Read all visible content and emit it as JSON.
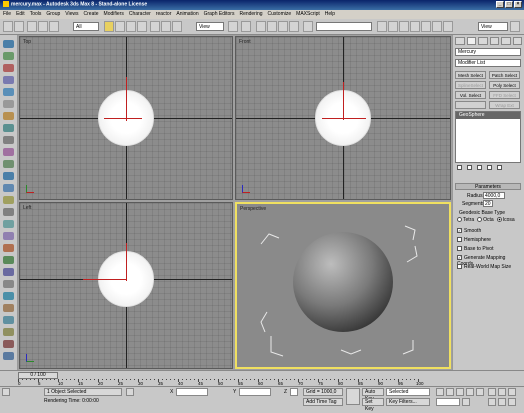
{
  "window": {
    "title": "mercury.max - Autodesk 3ds Max 8 - Stand-alone License"
  },
  "menu": [
    "File",
    "Edit",
    "Tools",
    "Group",
    "Views",
    "Create",
    "Modifiers",
    "Character",
    "reactor",
    "Animation",
    "Graph Editors",
    "Rendering",
    "Customize",
    "MAXScript",
    "Help"
  ],
  "toolbar": {
    "selection_filter": "All",
    "refcoord": "View",
    "named_selection": "",
    "view_dropdown": "View"
  },
  "viewports": {
    "top": "Top",
    "front": "Front",
    "left": "Left",
    "perspective": "Perspective"
  },
  "panel": {
    "object_name": "Mercury",
    "modifier_list": "Modifier List",
    "buttons": [
      "Mesh Select",
      "Patch Select",
      "SplineSelect",
      "Poly Select",
      "Vol. Select",
      "FFD Select",
      "",
      "Wrap Ext"
    ],
    "stack_item": "GeoSphere",
    "rollout": "Parameters",
    "radius_label": "Radius:",
    "radius_value": "4000,0",
    "segments_label": "Segments:",
    "segments_value": "20",
    "geodesic_label": "Geodesic Base Type",
    "types": [
      "Tetra",
      "Octa",
      "Icosa"
    ],
    "options": [
      "Smooth",
      "Hemisphere",
      "Base to Pivot",
      "Generate Mapping Coords.",
      "Real-World Map Size"
    ]
  },
  "timeline": {
    "slider": "0 / 100",
    "ticks": [
      "0",
      "5",
      "10",
      "15",
      "20",
      "25",
      "30",
      "35",
      "40",
      "45",
      "50",
      "55",
      "60",
      "65",
      "70",
      "75",
      "80",
      "85",
      "90",
      "95",
      "100"
    ]
  },
  "status": {
    "selected": "1 Object Selected",
    "render_time": "Rendering Time: 0:00:00",
    "x_label": "X",
    "y_label": "Y",
    "z_label": "Z",
    "grid": "Grid = 1000,0",
    "add_time_tag": "Add Time Tag",
    "auto_key": "Auto Key",
    "set_key": "Set Key",
    "selected_dropdown": "Selected",
    "key_filters": "Key Filters..."
  }
}
